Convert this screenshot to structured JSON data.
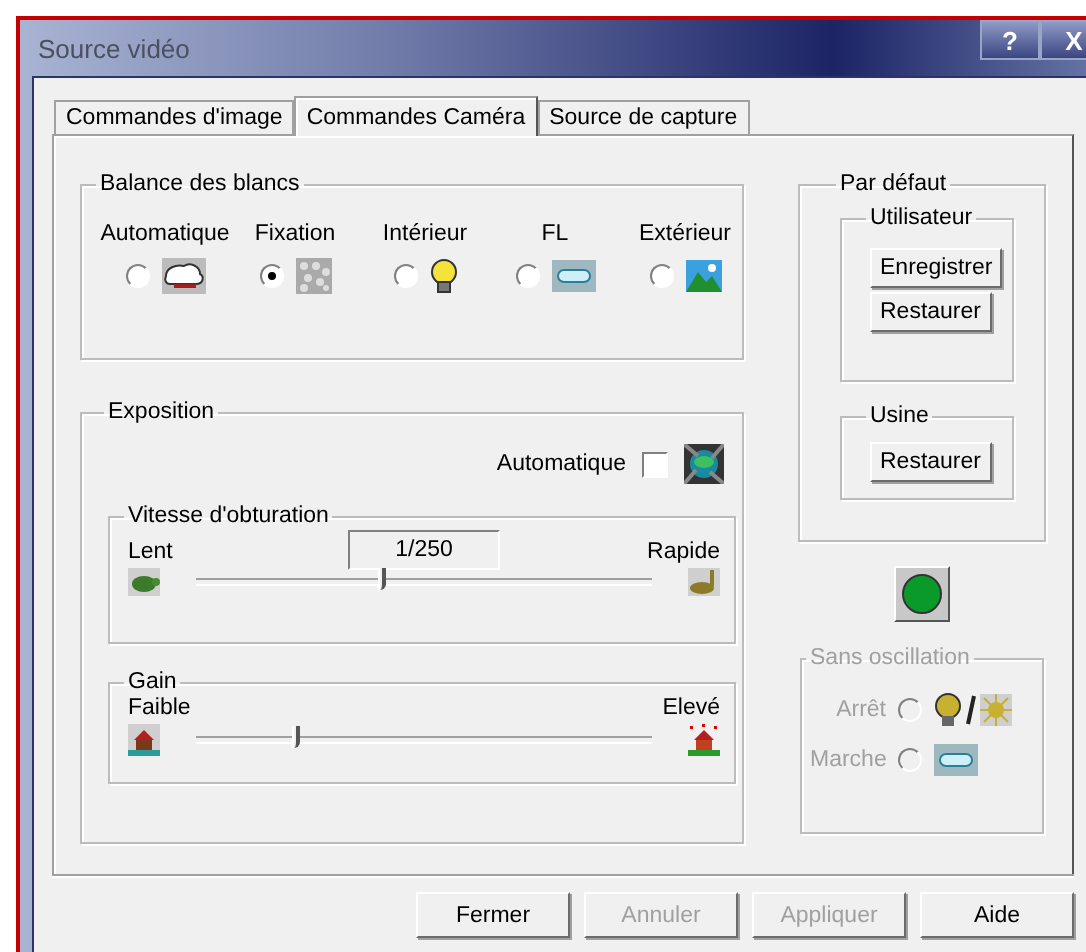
{
  "window": {
    "title": "Source vidéo",
    "title_buttons": [
      {
        "kind": "help",
        "label": "?"
      },
      {
        "kind": "close",
        "label": "X"
      }
    ]
  },
  "tabs": [
    {
      "label": "Commandes d'image",
      "selected": false
    },
    {
      "label": "Commandes Caméra",
      "selected": true
    },
    {
      "label": "Source de capture",
      "selected": false
    }
  ],
  "white_balance": {
    "title": "Balance des blancs",
    "options": [
      {
        "kind": "auto",
        "label": "Automatique",
        "selected": false
      },
      {
        "kind": "fixed",
        "label": "Fixation",
        "selected": true
      },
      {
        "kind": "indoor",
        "label": "Intérieur",
        "selected": false
      },
      {
        "kind": "fluorescent",
        "label": "FL",
        "selected": false
      },
      {
        "kind": "outdoor",
        "label": "Extérieur",
        "selected": false
      }
    ]
  },
  "exposure": {
    "title": "Exposition",
    "auto": {
      "label": "Automatique",
      "checked": false
    },
    "shutter": {
      "title": "Vitesse d'obturation",
      "value": "1/250",
      "min_label": "Lent",
      "max_label": "Rapide",
      "level": 0.41
    },
    "gain": {
      "title": "Gain",
      "min_label": "Faible",
      "max_label": "Elevé",
      "level": 0.22
    }
  },
  "defaults": {
    "title": "Par défaut",
    "user": {
      "title": "Utilisateur",
      "buttons": [
        "Enregistrer",
        "Restaurer"
      ]
    },
    "factory": {
      "title": "Usine",
      "buttons": [
        "Restaurer"
      ]
    }
  },
  "indicator": {
    "on": true
  },
  "anti_flicker": {
    "title": "Sans oscillation",
    "disabled": true,
    "options": [
      {
        "kind": "off",
        "label": "Arrêt",
        "selected": false
      },
      {
        "kind": "on",
        "label": "Marche",
        "selected": false
      }
    ]
  },
  "buttons": [
    {
      "label": "Fermer",
      "disabled": false
    },
    {
      "label": "Annuler",
      "disabled": true
    },
    {
      "label": "Appliquer",
      "disabled": true
    },
    {
      "label": "Aide",
      "disabled": false
    }
  ]
}
